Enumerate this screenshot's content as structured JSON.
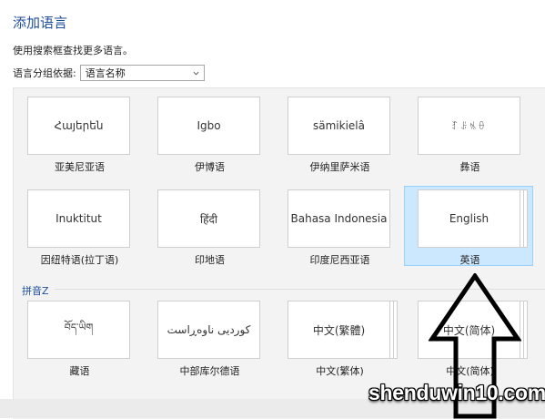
{
  "header": {
    "title": "添加语言",
    "subtitle": "使用搜索框查找更多语言。"
  },
  "grouping": {
    "label": "语言分组依据:",
    "selected": "语言名称"
  },
  "tiles": [
    {
      "native": "Հայերեն",
      "name": "亚美尼亚语"
    },
    {
      "native": "Igbo",
      "name": "伊博语"
    },
    {
      "native": "sämikielâ",
      "name": "伊纳里萨米语"
    },
    {
      "native": "ꆈꌠꁱꂷ",
      "name": "彝语"
    },
    {
      "native": "Inuktitut",
      "name": "因纽特语(拉丁语)"
    },
    {
      "native": "हिंदी",
      "name": "印地语"
    },
    {
      "native": "Bahasa Indonesia",
      "name": "印度尼西亚语"
    },
    {
      "native": "English",
      "name": "英语",
      "selected": true
    },
    {
      "native": "བོད་ཡིག",
      "name": "藏语"
    },
    {
      "native": "کوردیی ناوەڕاست",
      "name": "中部库尔德语"
    },
    {
      "native": "中文(繁體)",
      "name": "中文(繁体)"
    },
    {
      "native": "中文(简体)",
      "name": "中文(简体)"
    }
  ],
  "section": {
    "label": "拼音Z"
  },
  "watermark": "shenduwin10.com",
  "colors": {
    "accent": "#1f4e9a",
    "selection": "#cce8ff",
    "panel": "#f3f3f3"
  },
  "icons": [
    "chevron-down-icon",
    "up-arrow-icon"
  ]
}
